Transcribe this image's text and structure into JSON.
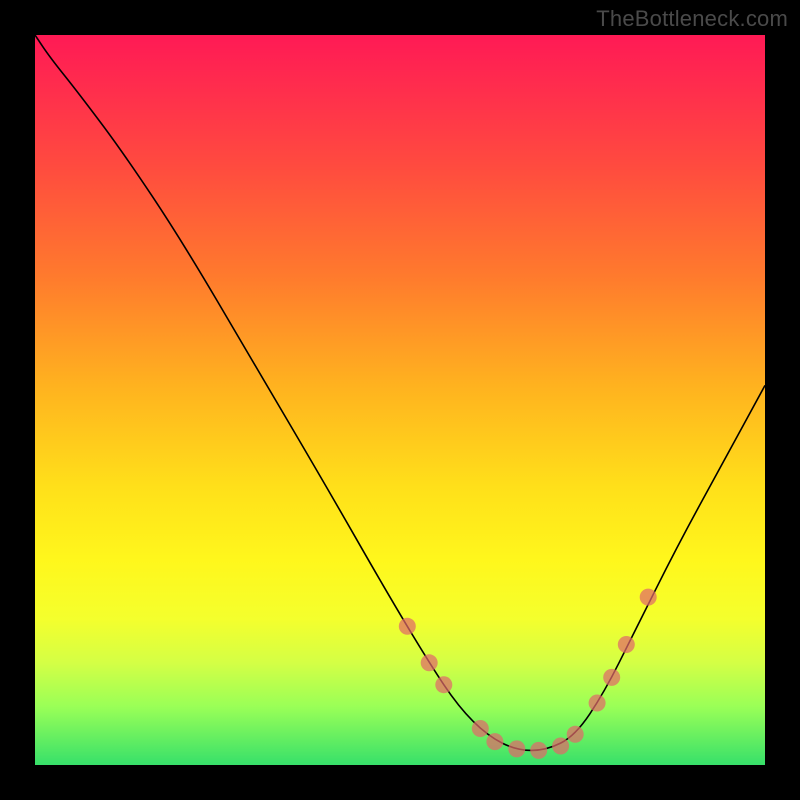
{
  "watermark": "TheBottleneck.com",
  "chart_data": {
    "type": "line",
    "title": "",
    "xlabel": "",
    "ylabel": "",
    "xlim": [
      0,
      100
    ],
    "ylim": [
      0,
      100
    ],
    "grid": false,
    "legend": false,
    "series": [
      {
        "name": "bottleneck-curve",
        "x": [
          0,
          2,
          6,
          12,
          20,
          30,
          40,
          48,
          54,
          58,
          62,
          66,
          70,
          74,
          78,
          82,
          88,
          94,
          100
        ],
        "y": [
          100,
          97,
          92,
          84,
          72,
          55,
          38,
          24,
          14,
          8,
          4,
          2,
          2,
          4,
          10,
          18,
          30,
          41,
          52
        ]
      }
    ],
    "markers": {
      "name": "highlight-dots",
      "x": [
        51,
        54,
        56,
        61,
        63,
        66,
        69,
        72,
        74,
        77,
        79,
        81,
        84
      ],
      "y": [
        19,
        14,
        11,
        5,
        3.2,
        2.2,
        2.0,
        2.6,
        4.2,
        8.5,
        12,
        16.5,
        23
      ]
    },
    "colors": {
      "gradient_top": "#ff1a55",
      "gradient_mid": "#ffe01a",
      "gradient_bottom": "#37e06a",
      "curve": "#000000",
      "marker": "#e06a6a"
    }
  }
}
